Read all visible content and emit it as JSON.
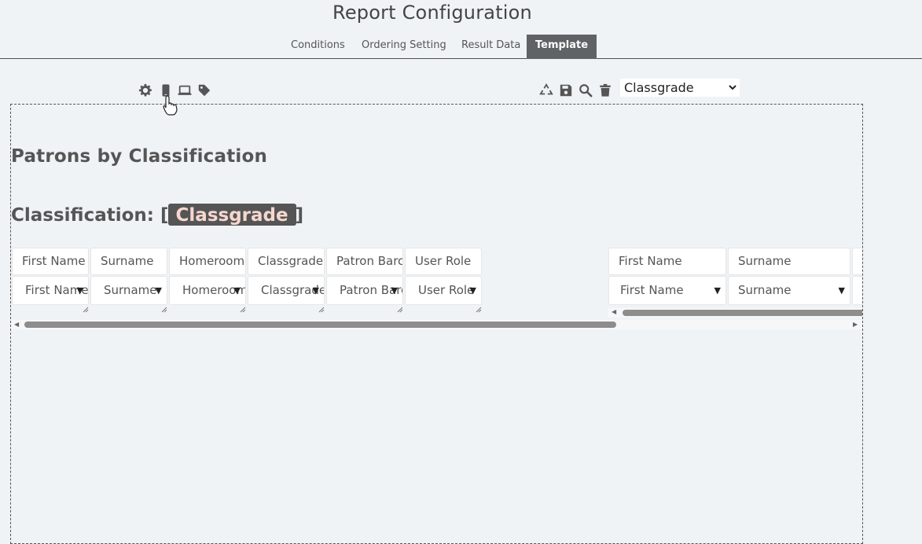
{
  "page": {
    "title": "Report Configuration"
  },
  "tabs": [
    {
      "label": "Conditions"
    },
    {
      "label": "Ordering Setting"
    },
    {
      "label": "Result Data"
    },
    {
      "label": "Template",
      "active": true
    }
  ],
  "toolbar_left": [
    "gear-icon",
    "mobile-icon",
    "laptop-icon",
    "tag-icon"
  ],
  "toolbar_right": [
    "recycle-icon",
    "save-icon",
    "search-icon",
    "trash-icon"
  ],
  "group_select": {
    "value": "Classgrade",
    "options": [
      "Classgrade"
    ]
  },
  "report": {
    "title": "Patrons by Classification",
    "group_prefix": "Classification: [",
    "group_field": "Classgrade",
    "group_suffix": "]"
  },
  "grid_left": {
    "headers": [
      "First Name",
      "Surname",
      "Homeroom",
      "Classgrade",
      "Patron Barcode",
      "User Role"
    ],
    "selects": [
      "First Name",
      "Surname",
      "Homeroom",
      "Classgrade",
      "Patron Barcode",
      "User Role"
    ]
  },
  "grid_right": {
    "headers": [
      "First Name",
      "Surname"
    ],
    "selects": [
      "First Name",
      "Surname"
    ]
  },
  "colors": {
    "active_tab": "#5f6366",
    "tag_bg": "#555555",
    "tag_text": "#f6d7cf",
    "background": "#eff3f6"
  }
}
